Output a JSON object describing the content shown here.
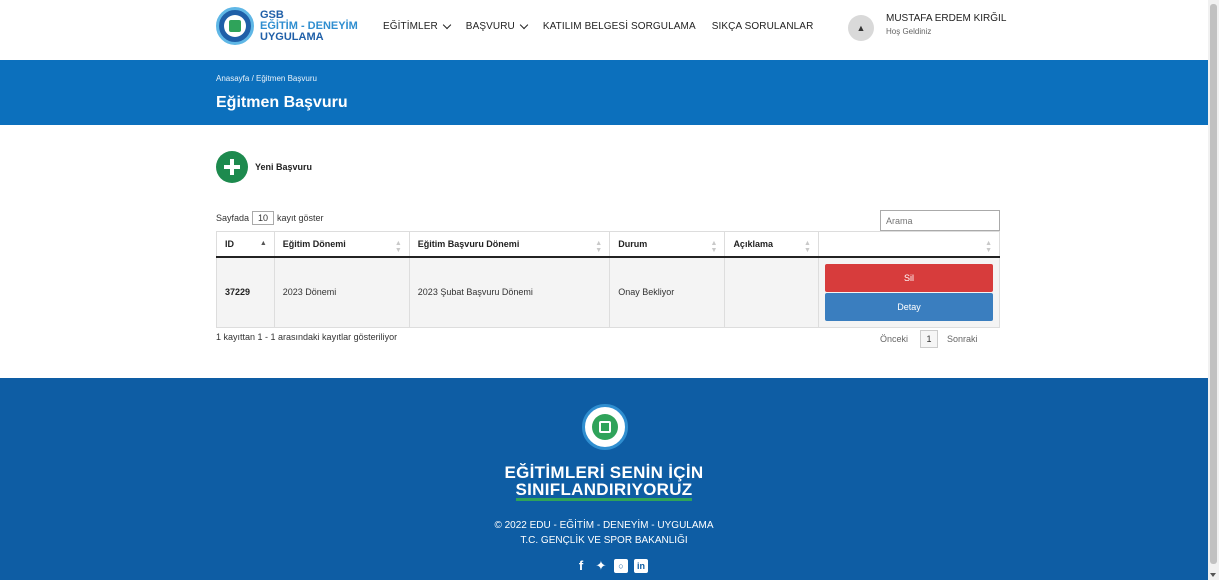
{
  "header": {
    "logo": {
      "line1": "GSB",
      "line2": "EĞİTİM - DENEYİM",
      "line3": "UYGULAMA"
    },
    "nav": [
      {
        "label": "EĞİTİMLER",
        "has_dropdown": true
      },
      {
        "label": "BAŞVURU",
        "has_dropdown": true
      },
      {
        "label": "KATILIM BELGESİ SORGULAMA",
        "has_dropdown": false
      },
      {
        "label": "SIKÇA SORULANLAR",
        "has_dropdown": false
      }
    ],
    "user": {
      "name": "MUSTAFA ERDEM KIRĞIL",
      "greeting": "Hoş Geldiniz",
      "icon": "user-icon"
    }
  },
  "band": {
    "breadcrumb": "Anasayfa  /  Eğitmen Başvuru",
    "title": "Eğitmen Başvuru",
    "color": "#0c70bd"
  },
  "new_application": {
    "label": "Yeni Başvuru",
    "icon": "plus-circle-icon",
    "color": "#1d8a4e"
  },
  "table_controls": {
    "length_prefix": "Sayfada",
    "length_value": "10",
    "length_suffix": "kayıt göster",
    "search_placeholder": "Arama"
  },
  "table": {
    "columns": [
      "ID",
      "Eğitim Dönemi",
      "Eğitim Başvuru Dönemi",
      "Durum",
      "Açıklama",
      ""
    ],
    "rows": [
      {
        "id": "37229",
        "period": "2023 Dönemi",
        "application_period": "2023 Şubat Başvuru Dönemi",
        "status": "Onay Bekliyor",
        "description": "",
        "delete_label": "Sil",
        "detail_label": "Detay"
      }
    ],
    "info": "1 kayıttan 1 - 1 arasındaki kayıtlar gösteriliyor",
    "pager": {
      "prev": "Önceki",
      "page": "1",
      "next": "Sonraki"
    }
  },
  "footer": {
    "slogan_line1": "EĞİTİMLERİ SENİN İÇİN",
    "slogan_line2": "SINIFLANDIRIYORUZ",
    "copyright": "© 2022 EDU - EĞİTİM - DENEYİM - UYGULAMA",
    "ministry": "T.C. GENÇLİK VE SPOR BAKANLIĞI",
    "social": [
      "facebook-icon",
      "twitter-icon",
      "instagram-icon",
      "linkedin-icon"
    ],
    "color": "#0e5da4"
  }
}
